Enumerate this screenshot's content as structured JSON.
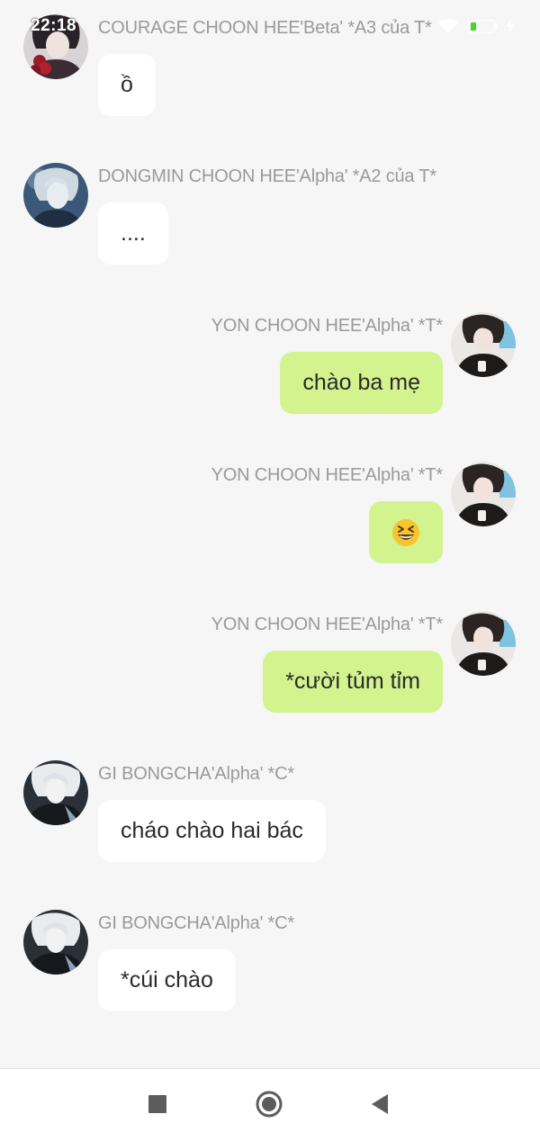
{
  "status_bar": {
    "time": "22:18",
    "battery_color": "#4cd137",
    "icons": [
      "wifi-icon",
      "battery-icon",
      "charging-icon"
    ]
  },
  "messages": [
    {
      "sender": "COURAGE CHOON HEE'Beta' *A3 của T*",
      "text": "ồ",
      "side": "left",
      "avatar": "avatar-dark-hair-red-roses"
    },
    {
      "sender": "DONGMIN CHOON HEE'Alpha' *A2 của T*",
      "text": "....",
      "side": "left",
      "avatar": "avatar-silver-hair-blue"
    },
    {
      "sender": "YON CHOON HEE'Alpha' *T*",
      "text": "chào ba mẹ",
      "side": "right",
      "avatar": "avatar-dark-hair-black-jacket"
    },
    {
      "sender": "YON CHOON HEE'Alpha' *T*",
      "text": "",
      "emoji": "grinning-squinting-face-emoji",
      "side": "right",
      "avatar": "avatar-dark-hair-black-jacket"
    },
    {
      "sender": "YON CHOON HEE'Alpha' *T*",
      "text": "*cười tủm tỉm",
      "side": "right",
      "avatar": "avatar-dark-hair-black-jacket"
    },
    {
      "sender": "GI BONGCHA'Alpha' *C*",
      "text": "cháo chào hai bác",
      "side": "left",
      "avatar": "avatar-white-hair-black-coat"
    },
    {
      "sender": "GI BONGCHA'Alpha' *C*",
      "text": "*cúi chào",
      "side": "left",
      "avatar": "avatar-white-hair-black-coat"
    }
  ],
  "colors": {
    "background": "#f6f6f6",
    "own_bubble": "#d2f38e",
    "other_bubble": "#ffffff",
    "sender_name": "#9a9a9a"
  },
  "nav_bar": {
    "buttons": [
      "recent-apps-button",
      "home-button",
      "back-button"
    ]
  }
}
